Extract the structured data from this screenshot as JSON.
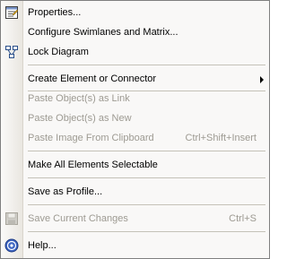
{
  "menu": {
    "properties": {
      "label": "Properties...",
      "icon": "properties-icon"
    },
    "swimlanes": {
      "label": "Configure Swimlanes and Matrix..."
    },
    "lock_diagram": {
      "label": "Lock Diagram",
      "icon": "lock-diagram-icon"
    },
    "create_element": {
      "label": "Create Element or Connector"
    },
    "paste_link": {
      "label": "Paste Object(s) as Link",
      "disabled": true
    },
    "paste_new": {
      "label": "Paste Object(s) as New",
      "disabled": true
    },
    "paste_image": {
      "label": "Paste Image From Clipboard",
      "shortcut": "Ctrl+Shift+Insert",
      "disabled": true
    },
    "make_selectable": {
      "label": "Make All Elements Selectable"
    },
    "save_profile": {
      "label": "Save as Profile..."
    },
    "save_changes": {
      "label": "Save Current Changes",
      "shortcut": "Ctrl+S",
      "disabled": true,
      "icon": "save-icon"
    },
    "help": {
      "label": "Help...",
      "icon": "help-icon"
    }
  },
  "colors": {
    "menu_bg": "#f9f8f7",
    "gutter": "#e9e6e0",
    "disabled_text": "#9d9a92",
    "separator": "#c5c2b8"
  }
}
